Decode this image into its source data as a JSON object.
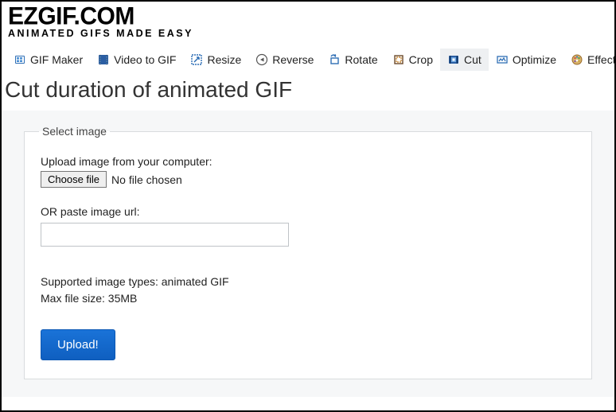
{
  "logo": {
    "title": "EZGIF.COM",
    "subtitle": "ANIMATED GIFS MADE EASY"
  },
  "nav": {
    "items": [
      {
        "label": "GIF Maker",
        "icon": "gif-maker-icon"
      },
      {
        "label": "Video to GIF",
        "icon": "video-to-gif-icon"
      },
      {
        "label": "Resize",
        "icon": "resize-icon"
      },
      {
        "label": "Reverse",
        "icon": "reverse-icon"
      },
      {
        "label": "Rotate",
        "icon": "rotate-icon"
      },
      {
        "label": "Crop",
        "icon": "crop-icon"
      },
      {
        "label": "Cut",
        "icon": "cut-icon",
        "active": true
      },
      {
        "label": "Optimize",
        "icon": "optimize-icon"
      },
      {
        "label": "Effects",
        "icon": "effects-icon"
      }
    ]
  },
  "page": {
    "title": "Cut duration of animated GIF"
  },
  "form": {
    "legend": "Select image",
    "upload_label": "Upload image from your computer:",
    "choose_file_btn": "Choose file",
    "no_file_text": "No file chosen",
    "url_label": "OR paste image url:",
    "url_value": "",
    "supported_label": "Supported image types: animated GIF",
    "maxsize_label": "Max file size: 35MB",
    "submit_label": "Upload!"
  }
}
